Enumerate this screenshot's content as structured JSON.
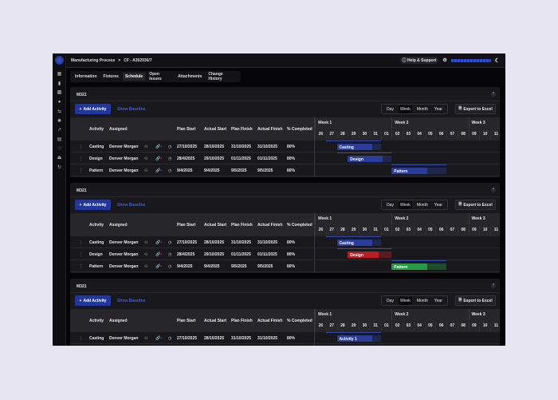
{
  "header": {
    "breadcrumb": [
      "Manufacturing Process",
      "CF - A302936/7"
    ],
    "separator": ">",
    "help": "Help & Support"
  },
  "tabs": [
    "Information",
    "Fixtures",
    "Schedule",
    "Open Issues",
    "Attachments",
    "Change History"
  ],
  "active_tab": "Schedule",
  "sidebar_icons": [
    "dashboard-icon",
    "chart-icon",
    "grid-icon",
    "settings-icon",
    "transfer-icon",
    "gear-icon",
    "trend-icon",
    "table-icon",
    "heart-icon",
    "upload-icon",
    "refresh-icon"
  ],
  "toolbar": {
    "add_label": "Add Activity",
    "baseline_label": "Show Baseline",
    "views": [
      "Day",
      "Week",
      "Month",
      "Year"
    ],
    "active_view": "Week",
    "export_label": "Export to Excel"
  },
  "columns": [
    "Activity",
    "Assigned",
    "Plan Start",
    "Actual Start",
    "Plan Finish",
    "Actual Finish",
    "% Completed"
  ],
  "weeks": [
    "Week 1",
    "Week 2",
    "Week 3"
  ],
  "days": [
    "26",
    "27",
    "28",
    "29",
    "30",
    "31",
    "01",
    "02",
    "03",
    "04",
    "05",
    "06",
    "07",
    "08",
    "09",
    "10",
    "11"
  ],
  "colors": {
    "blue": "#2a3d9a",
    "red": "#b81c25",
    "green": "#269a43"
  },
  "sections": [
    {
      "title": "M321",
      "rows": [
        {
          "activity": "Casting",
          "assigned": "Denver Morgan",
          "plan_start": "27/10/2025",
          "actual_start": "28/10/2025",
          "plan_finish": "31/10/2025",
          "actual_finish": "31/10/2025",
          "pct": "80%",
          "bar": {
            "label": "Casting",
            "start": 2,
            "len": 4,
            "progress": 0.8,
            "color": "blue",
            "bl_start": 1,
            "bl_len": 5
          }
        },
        {
          "activity": "Design",
          "assigned": "Denver Morgan",
          "plan_start": "28/4/2025",
          "actual_start": "29/10/2025",
          "plan_finish": "01/11/2025",
          "actual_finish": "01/11/2025",
          "pct": "80%",
          "bar": {
            "label": "Design",
            "start": 3,
            "len": 4,
            "progress": 0.8,
            "color": "blue",
            "bl_start": 2,
            "bl_len": 5
          }
        },
        {
          "activity": "Pattern",
          "assigned": "Denver Morgan",
          "plan_start": "9/4/2025",
          "actual_start": "9/4/2025",
          "plan_finish": "9/5/2025",
          "actual_finish": "9/5/2025",
          "pct": "80%",
          "bar": {
            "label": "Pattern",
            "start": 7,
            "len": 5,
            "progress": 0.65,
            "color": "blue",
            "bl_start": 7,
            "bl_len": 5
          }
        }
      ]
    },
    {
      "title": "M321",
      "rows": [
        {
          "activity": "Casting",
          "assigned": "Denver Morgan",
          "plan_start": "27/10/2025",
          "actual_start": "28/10/2025",
          "plan_finish": "31/10/2025",
          "actual_finish": "31/10/2025",
          "pct": "80%",
          "bar": {
            "label": "Casting",
            "start": 2,
            "len": 4,
            "progress": 0.8,
            "color": "blue",
            "bl_start": 1,
            "bl_len": 5
          }
        },
        {
          "activity": "Design",
          "assigned": "Denver Morgan",
          "plan_start": "28/4/2025",
          "actual_start": "29/10/2025",
          "plan_finish": "01/11/2025",
          "actual_finish": "01/11/2025",
          "pct": "80%",
          "bar": {
            "label": "Design",
            "start": 3,
            "len": 4,
            "progress": 0.7,
            "color": "red",
            "bl_start": 2,
            "bl_len": 5
          }
        },
        {
          "activity": "Pattern",
          "assigned": "Denver Morgan",
          "plan_start": "9/4/2025",
          "actual_start": "9/4/2025",
          "plan_finish": "9/5/2025",
          "actual_finish": "9/5/2025",
          "pct": "80%",
          "bar": {
            "label": "Pattern",
            "start": 7,
            "len": 5,
            "progress": 0.65,
            "color": "green",
            "bl_start": 7,
            "bl_len": 5
          }
        }
      ]
    },
    {
      "title": "M321",
      "rows": [
        {
          "activity": "Casting",
          "assigned": "Denver Morgan",
          "plan_start": "27/10/2025",
          "actual_start": "28/10/2025",
          "plan_finish": "31/10/2025",
          "actual_finish": "31/10/2025",
          "pct": "80%",
          "bar": {
            "label": "Activity 1",
            "start": 2,
            "len": 4,
            "progress": 0.8,
            "color": "blue",
            "bl_start": 1,
            "bl_len": 5
          }
        }
      ]
    }
  ]
}
